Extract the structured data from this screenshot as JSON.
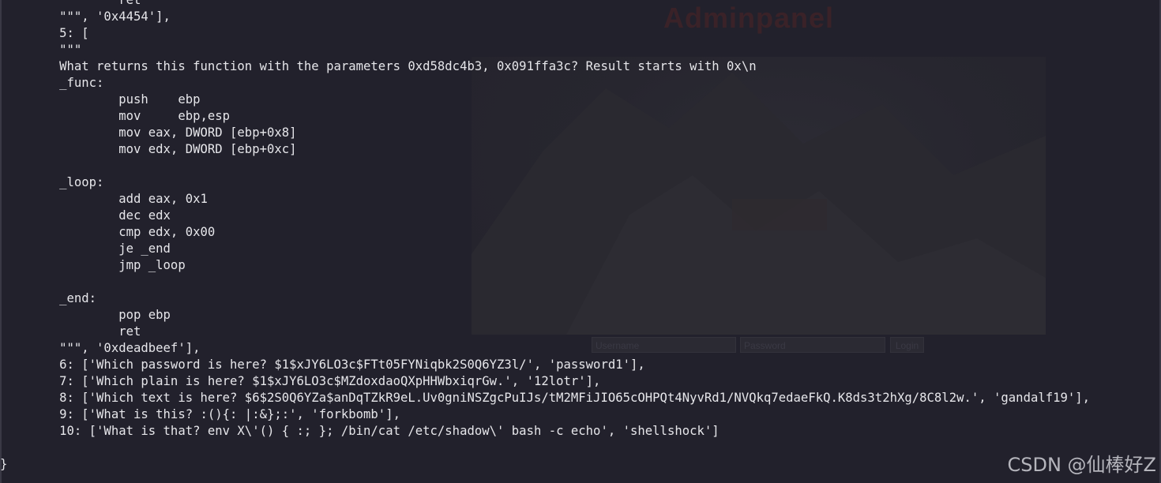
{
  "background_panel": {
    "title": "Adminpanel",
    "username_placeholder": "Username",
    "password_placeholder": "Password",
    "login_label": "Login"
  },
  "terminal": {
    "lines": [
      "                ret",
      "        \"\"\", '0x4454'],",
      "        5: [",
      "        \"\"\"",
      "        What returns this function with the parameters 0xd58dc4b3, 0x091ffa3c? Result starts with 0x\\n",
      "        _func:",
      "                push    ebp",
      "                mov     ebp,esp",
      "                mov eax, DWORD [ebp+0x8]",
      "                mov edx, DWORD [ebp+0xc]",
      "",
      "        _loop:",
      "                add eax, 0x1",
      "                dec edx",
      "                cmp edx, 0x00",
      "                je _end",
      "                jmp _loop",
      "",
      "        _end:",
      "                pop ebp",
      "                ret",
      "        \"\"\", '0xdeadbeef'],",
      "        6: ['Which password is here? $1$xJY6LO3c$FTt05FYNiqbk2S0Q6YZ3l/', 'password1'],",
      "        7: ['Which plain is here? $1$xJY6LO3c$MZdoxdaoQXpHHWbxiqrGw.', '12lotr'],",
      "        8: ['Which text is here? $6$2S0Q6YZa$anDqTZkR9eL.Uv0gniNSZgcPuIJs/tM2MFiJIO65cOHPQt4NyvRd1/NVQkq7edaeFkQ.K8ds3t2hXg/8C8l2w.', 'gandalf19'],",
      "        9: ['What is this? :(){: |:&};:', 'forkbomb'],",
      "        10: ['What is that? env X\\'() { :; }; /bin/cat /etc/shadow\\' bash -c echo', 'shellshock']",
      "",
      "}"
    ]
  },
  "watermark": "CSDN @仙棒好Z"
}
